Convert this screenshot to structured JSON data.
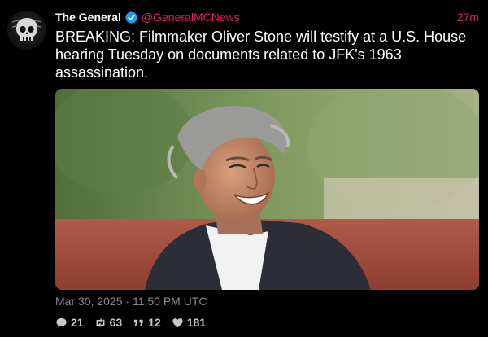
{
  "tweet": {
    "author_name": "The General",
    "handle": "@GeneralMCNews",
    "relative_time": "27m",
    "text": "BREAKING: Filmmaker Oliver Stone will testify at a U.S. House hearing Tuesday on documents related to JFK's 1963 assassination.",
    "timestamp": "Mar 30, 2025 · 11:50 PM UTC"
  },
  "stats": {
    "replies": "21",
    "retweets": "63",
    "quotes": "12",
    "likes": "181"
  },
  "icons": {
    "verified": "verified-badge-icon",
    "reply": "speech-bubble-icon",
    "retweet": "retweet-icon",
    "quote": "quote-icon",
    "like": "heart-icon"
  },
  "colors": {
    "background": "#000000",
    "accent": "#e0245e",
    "verified": "#1d9bf0",
    "muted": "#8b8b8b"
  }
}
